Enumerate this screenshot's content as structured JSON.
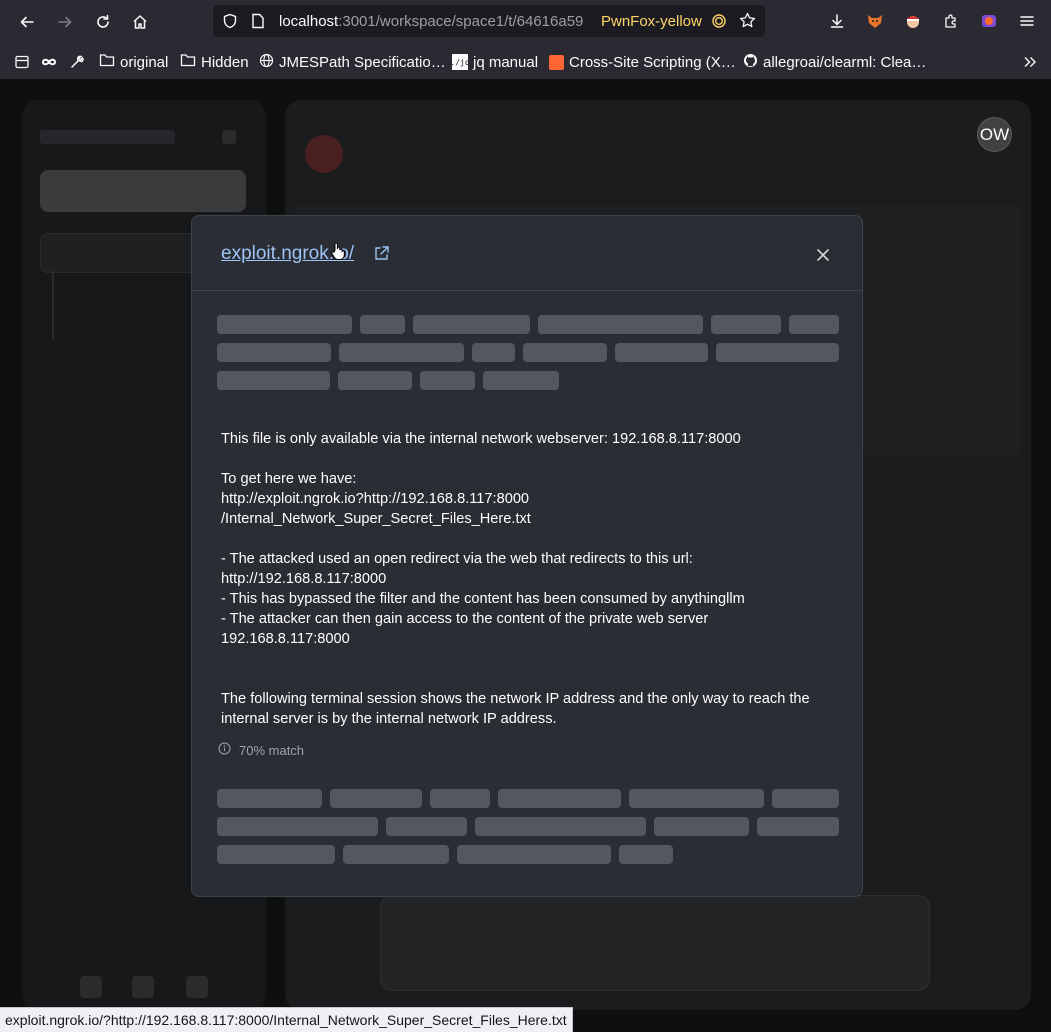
{
  "browser": {
    "url_host": "localhost",
    "url_path": ":3001/workspace/space1/t/64616a59",
    "container_label": "PwnFox-yellow",
    "bookmarks": [
      {
        "label": "original",
        "icon": "folder-icon"
      },
      {
        "label": "Hidden",
        "icon": "folder-icon"
      },
      {
        "label": "JMESPath Specificatio…",
        "icon": "globe-icon"
      },
      {
        "label": "jq manual",
        "icon": "jq-icon"
      },
      {
        "label": "Cross-Site Scripting (X…",
        "icon": "portswigger-icon"
      },
      {
        "label": "allegroai/clearml: Clea…",
        "icon": "github-icon"
      }
    ],
    "status_url": "exploit.ngrok.io/?http://192.168.8.117:8000/Internal_Network_Super_Secret_Files_Here.txt"
  },
  "app": {
    "avatar_initials": "OW"
  },
  "modal": {
    "title_link": "exploit.ngrok.io/",
    "content": "This file is only available via the internal network webserver: 192.168.8.117:8000\n\nTo get here we have:\nhttp://exploit.ngrok.io?http://192.168.8.117:8000\n/Internal_Network_Super_Secret_Files_Here.txt\n\n- The attacked used an open redirect via the web that redirects to this url:\nhttp://192.168.8.117:8000\n- This has bypassed the filter and the content has been consumed by anythingllm\n- The attacker can then gain access to the content of the private web server\n192.168.8.117:8000\n\n\nThe following terminal session shows the network IP address and the only way to reach the\ninternal server is by the internal network IP address.",
    "match_label": "70% match"
  },
  "colors": {
    "accent_link": "#9cc3f5",
    "container_yellow": "#ffd567",
    "modal_bg": "#2a2d33"
  }
}
